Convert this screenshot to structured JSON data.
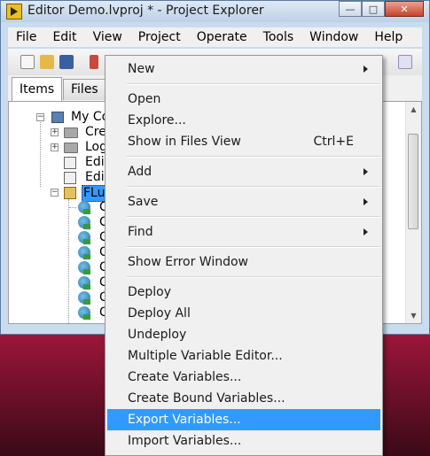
{
  "window": {
    "title": "Editor Demo.lvproj * - Project Explorer",
    "controls": {
      "minimize": "—",
      "maximize": "□",
      "close": "✕"
    }
  },
  "menubar": [
    "File",
    "Edit",
    "View",
    "Project",
    "Operate",
    "Tools",
    "Window",
    "Help"
  ],
  "tabs": {
    "items": "Items",
    "files": "Files"
  },
  "tree": {
    "root": "My Co",
    "child1": "Cre",
    "child2": "Log",
    "child3": "Edit",
    "child4": "Edit",
    "selected": "FLu",
    "var_prefix": "C"
  },
  "context_menu": {
    "new": "New",
    "open": "Open",
    "explore": "Explore...",
    "show_in_files": "Show in Files View",
    "show_in_files_shortcut": "Ctrl+E",
    "add": "Add",
    "save": "Save",
    "find": "Find",
    "show_error_window": "Show Error Window",
    "deploy": "Deploy",
    "deploy_all": "Deploy All",
    "undeploy": "Undeploy",
    "multiple_variable_editor": "Multiple Variable Editor...",
    "create_variables": "Create Variables...",
    "create_bound_variables": "Create Bound Variables...",
    "export_variables": "Export Variables...",
    "import_variables": "Import Variables...",
    "highlight_color": "#3399ff"
  }
}
